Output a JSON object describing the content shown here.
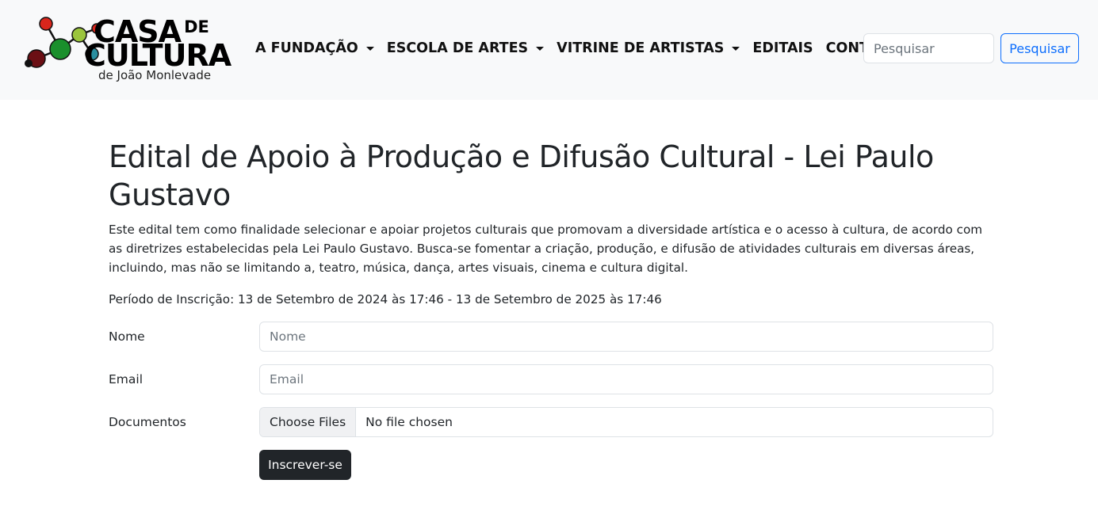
{
  "logo": {
    "line1": "CASA",
    "line1_suffix": "DE",
    "line2": "CULTURA",
    "line3": "de João Monlevade",
    "dot_colors": [
      "#d9261c",
      "#1a8f2c",
      "#9bc53d",
      "#2a8fa0",
      "#6b0f14",
      "#111111"
    ]
  },
  "nav": {
    "items": [
      {
        "label": "A FUNDAÇÃO",
        "dropdown": true
      },
      {
        "label": "ESCOLA DE ARTES",
        "dropdown": true
      },
      {
        "label": "VITRINE DE ARTISTAS",
        "dropdown": true
      },
      {
        "label": "EDITAIS",
        "dropdown": false
      },
      {
        "label": "CONTATO",
        "dropdown": true
      }
    ],
    "search_placeholder": "Pesquisar",
    "search_button": "Pesquisar"
  },
  "main": {
    "title": "Edital de Apoio à Produção e Difusão Cultural - Lei Paulo Gustavo",
    "description": "Este edital tem como finalidade selecionar e apoiar projetos culturais que promovam a diversidade artística e o acesso à cultura, de acordo com as diretrizes estabelecidas pela Lei Paulo Gustavo. Busca-se fomentar a criação, produção, e difusão de atividades culturais em diversas áreas, incluindo, mas não se limitando a, teatro, música, dança, artes visuais, cinema e cultura digital.",
    "period": "Período de Inscrição: 13 de Setembro de 2024 às 17:46 - 13 de Setembro de 2025 às 17:46"
  },
  "form": {
    "name_label": "Nome",
    "name_placeholder": "Nome",
    "email_label": "Email",
    "email_placeholder": "Email",
    "docs_label": "Documentos",
    "file_button": "Choose Files",
    "file_status": "No file chosen",
    "submit": "Inscrever-se"
  },
  "colors": {
    "navbar_bg": "#f8f9fa",
    "primary": "#0d6efd",
    "dark": "#212529"
  }
}
